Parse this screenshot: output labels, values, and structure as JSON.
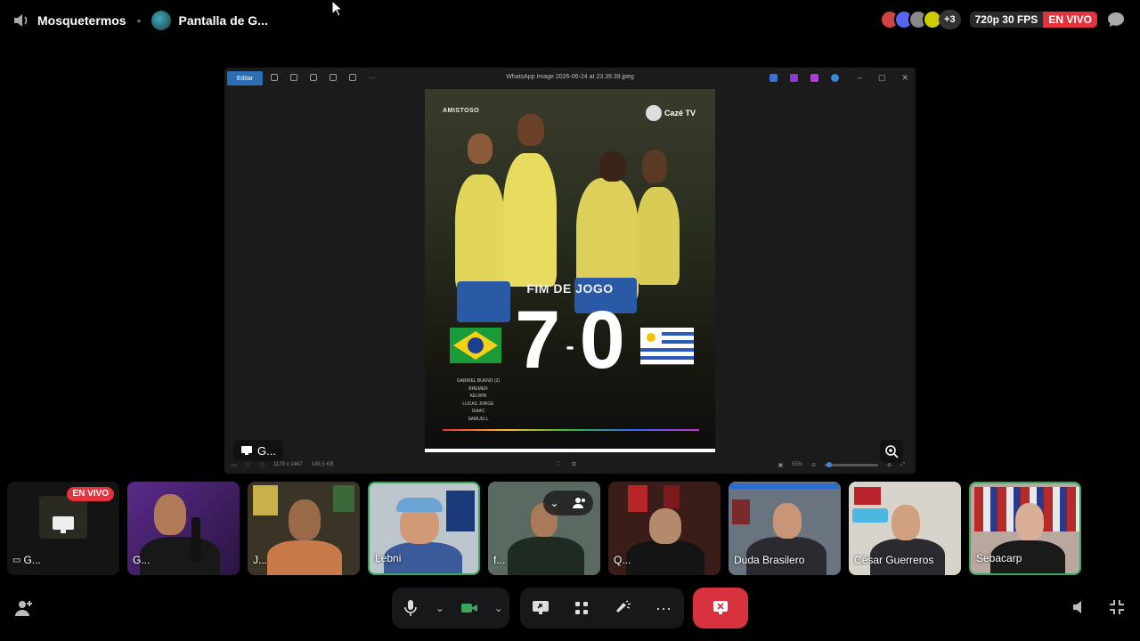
{
  "topbar": {
    "server_name": "Mosquetermos",
    "stream_label": "Pantalla de G...",
    "extra_count": "+3",
    "quality": "720p 30 FPS",
    "live_badge": "EN VIVO"
  },
  "shared_screen": {
    "edit_label": "Editar",
    "window_title": "WhatsApp Image 2026-06-24 at 23.39.39.jpeg",
    "image": {
      "tag": "AMISTOSO",
      "brand": "Cazé TV",
      "headline": "FIM DE JOGO",
      "home_score": "7",
      "away_score": "0",
      "scorers": [
        "GABRIEL BUENO (2)",
        "BREMER",
        "KELWIN",
        "LUCAS JORGE",
        "ISAAC",
        "SAMUELL"
      ]
    },
    "status": {
      "dimensions": "1170 x 1467",
      "filesize": "145,5 KB",
      "zoom": "55%"
    },
    "label": "G..."
  },
  "participants": [
    {
      "name": "G...",
      "live": "EN VIVO"
    },
    {
      "name": "G..."
    },
    {
      "name": "J..."
    },
    {
      "name": "Lebni"
    },
    {
      "name": "f..."
    },
    {
      "name": "Q..."
    },
    {
      "name": "Duda Brasilero"
    },
    {
      "name": "César Guerreros"
    },
    {
      "name": "Sebacarp"
    }
  ]
}
